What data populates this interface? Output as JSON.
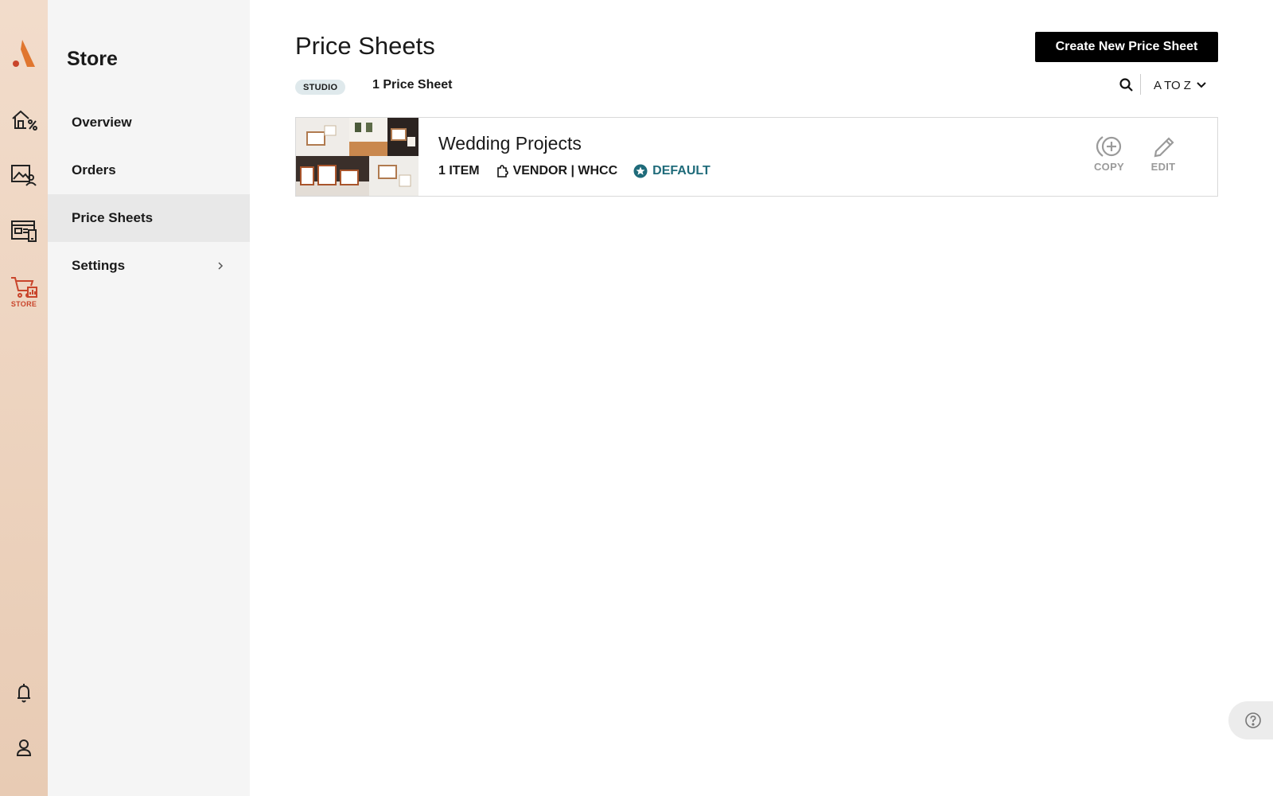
{
  "rail": {
    "store_label": "STORE",
    "brand_color": "#d9652b",
    "items": [
      {
        "icon": "home-discount-icon"
      },
      {
        "icon": "gallery-client-icon"
      },
      {
        "icon": "website-mobile-icon"
      },
      {
        "icon": "store-cart-icon",
        "label": "STORE",
        "active": true
      },
      {
        "icon": "bell-icon"
      },
      {
        "icon": "user-icon"
      }
    ]
  },
  "sidebar": {
    "title": "Store",
    "items": [
      {
        "label": "Overview"
      },
      {
        "label": "Orders"
      },
      {
        "label": "Price Sheets",
        "active": true
      },
      {
        "label": "Settings",
        "has_chevron": true
      }
    ]
  },
  "main": {
    "title": "Price Sheets",
    "create_button": "Create New Price Sheet",
    "badge": "STUDIO",
    "count": "1 Price Sheet",
    "sort": "A TO Z",
    "sheets": [
      {
        "title": "Wedding Projects",
        "items": "1 ITEM",
        "vendor": "VENDOR | WHCC",
        "default": "DEFAULT",
        "copy_label": "COPY",
        "edit_label": "EDIT"
      }
    ]
  },
  "colors": {
    "default_teal": "#1f6b7a",
    "action_gray": "#9a9a9a"
  }
}
